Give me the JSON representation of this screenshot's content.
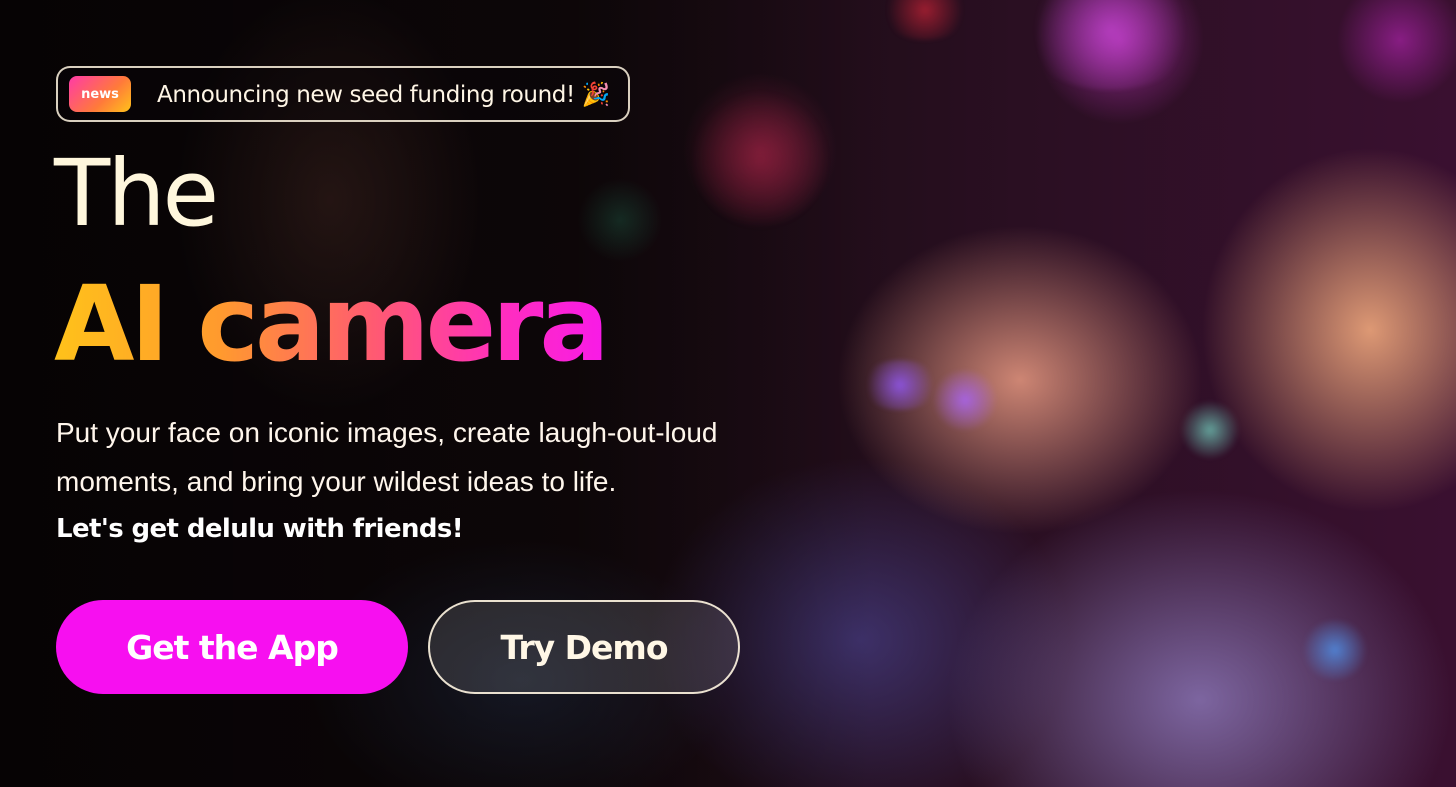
{
  "news": {
    "badge_label": "news",
    "announcement": "Announcing new seed funding round! 🎉"
  },
  "hero": {
    "title_line1": "The",
    "title_line2": "AI camera",
    "subtitle": "Put your face on iconic images, create laugh-out-loud moments, and bring your wildest ideas to life.",
    "tagline": "Let's get delulu with friends!"
  },
  "buttons": {
    "primary_label": "Get the App",
    "secondary_label": "Try Demo"
  },
  "colors": {
    "primary_button": "#f70ff0",
    "title_white": "#fff7dd",
    "gradient_start": "#ffc21a",
    "gradient_end": "#f81ae8"
  }
}
